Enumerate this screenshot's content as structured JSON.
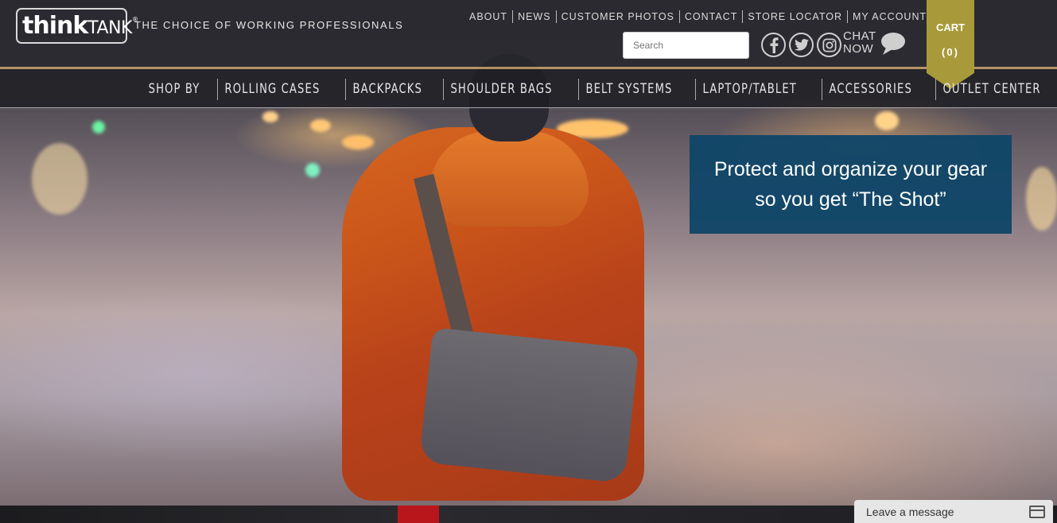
{
  "brand": {
    "logo_think": "think",
    "logo_tank": "TANK",
    "logo_reg": "®",
    "tagline": "THE CHOICE OF WORKING PROFESSIONALS"
  },
  "top_links": [
    "ABOUT",
    "NEWS",
    "CUSTOMER PHOTOS",
    "CONTACT",
    "STORE LOCATOR",
    "MY ACCOUNT"
  ],
  "search": {
    "placeholder": "Search"
  },
  "social": {
    "facebook_glyph": "f",
    "twitter_glyph": "t",
    "instagram_glyph": "◎"
  },
  "chat": {
    "line1": "CHAT",
    "line2": "NOW"
  },
  "cart": {
    "label": "CART",
    "count": "(0)",
    "color": "#a89a3a"
  },
  "main_nav": [
    "SHOP BY",
    "ROLLING CASES",
    "BACKPACKS",
    "SHOULDER BAGS",
    "BELT SYSTEMS",
    "LAPTOP/TABLET",
    "ACCESSORIES",
    "OUTLET CENTER"
  ],
  "hero": {
    "promo_text": "Protect and organize your gear so you get “The Shot”",
    "promo_bg": "#104668"
  },
  "chat_widget": {
    "label": "Leave a message"
  }
}
